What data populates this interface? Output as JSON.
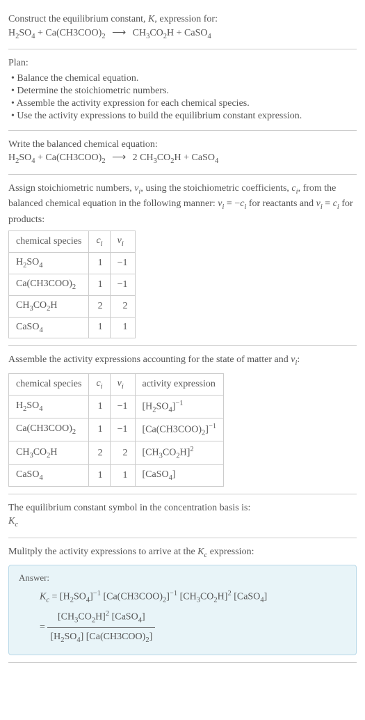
{
  "prompt": {
    "line1_a": "Construct the equilibrium constant, ",
    "line1_k": "K",
    "line1_b": ", expression for:",
    "eq_lhs1": "H",
    "eq_lhs1_sub1": "2",
    "eq_lhs1_mid": "SO",
    "eq_lhs1_sub2": "4",
    "eq_plus1": " + Ca(CH3COO)",
    "eq_plus1_sub": "2",
    "eq_arrow": "⟶",
    "eq_rhs1": "CH",
    "eq_rhs1_sub1": "3",
    "eq_rhs1_mid": "CO",
    "eq_rhs1_sub2": "2",
    "eq_rhs1_end": "H + CaSO",
    "eq_rhs1_sub3": "4"
  },
  "plan": {
    "title": "Plan:",
    "b1": "• Balance the chemical equation.",
    "b2": "• Determine the stoichiometric numbers.",
    "b3": "• Assemble the activity expression for each chemical species.",
    "b4": "• Use the activity expressions to build the equilibrium constant expression."
  },
  "balanced": {
    "title": "Write the balanced chemical equation:",
    "lhs1": "H",
    "lhs1_s1": "2",
    "lhs1_m": "SO",
    "lhs1_s2": "4",
    "plus": " + Ca(CH3COO)",
    "plus_s": "2",
    "arrow": "⟶",
    "rhs_coef": "2 CH",
    "rhs_s1": "3",
    "rhs_m": "CO",
    "rhs_s2": "2",
    "rhs_end": "H + CaSO",
    "rhs_s3": "4"
  },
  "stoich": {
    "text_a": "Assign stoichiometric numbers, ",
    "nu": "ν",
    "sub_i": "i",
    "text_b": ", using the stoichiometric coefficients, ",
    "c": "c",
    "text_c": ", from the balanced chemical equation in the following manner: ",
    "eq1": " = −",
    "text_d": " for reactants and ",
    "eq2": " = ",
    "text_e": " for products:",
    "h_species": "chemical species",
    "h_c": "c",
    "h_nu": "ν",
    "rows": [
      {
        "sp_a": "H",
        "sp_s1": "2",
        "sp_m": "SO",
        "sp_s2": "4",
        "sp_end": "",
        "c": "1",
        "nu": "−1"
      },
      {
        "sp_a": "Ca(CH3COO)",
        "sp_s1": "2",
        "sp_m": "",
        "sp_s2": "",
        "sp_end": "",
        "c": "1",
        "nu": "−1"
      },
      {
        "sp_a": "CH",
        "sp_s1": "3",
        "sp_m": "CO",
        "sp_s2": "2",
        "sp_end": "H",
        "c": "2",
        "nu": "2"
      },
      {
        "sp_a": "CaSO",
        "sp_s1": "4",
        "sp_m": "",
        "sp_s2": "",
        "sp_end": "",
        "c": "1",
        "nu": "1"
      }
    ]
  },
  "activity": {
    "text_a": "Assemble the activity expressions accounting for the state of matter and ",
    "text_b": ":",
    "h_species": "chemical species",
    "h_c": "c",
    "h_nu": "ν",
    "h_act": "activity expression",
    "rows": [
      {
        "sp_a": "H",
        "sp_s1": "2",
        "sp_m": "SO",
        "sp_s2": "4",
        "sp_end": "",
        "c": "1",
        "nu": "−1",
        "act_pre": "[H",
        "act_s1": "2",
        "act_m": "SO",
        "act_s2": "4",
        "act_end": "]",
        "act_exp": "−1"
      },
      {
        "sp_a": "Ca(CH3COO)",
        "sp_s1": "2",
        "sp_m": "",
        "sp_s2": "",
        "sp_end": "",
        "c": "1",
        "nu": "−1",
        "act_pre": "[Ca(CH3COO)",
        "act_s1": "2",
        "act_m": "",
        "act_s2": "",
        "act_end": "]",
        "act_exp": "−1"
      },
      {
        "sp_a": "CH",
        "sp_s1": "3",
        "sp_m": "CO",
        "sp_s2": "2",
        "sp_end": "H",
        "c": "2",
        "nu": "2",
        "act_pre": "[CH",
        "act_s1": "3",
        "act_m": "CO",
        "act_s2": "2",
        "act_end": "H]",
        "act_exp": "2"
      },
      {
        "sp_a": "CaSO",
        "sp_s1": "4",
        "sp_m": "",
        "sp_s2": "",
        "sp_end": "",
        "c": "1",
        "nu": "1",
        "act_pre": "[CaSO",
        "act_s1": "4",
        "act_m": "",
        "act_s2": "",
        "act_end": "]",
        "act_exp": ""
      }
    ]
  },
  "symbol": {
    "text": "The equilibrium constant symbol in the concentration basis is:",
    "k": "K",
    "k_sub": "c"
  },
  "mult": {
    "text_a": "Mulitply the activity expressions to arrive at the ",
    "k": "K",
    "k_sub": "c",
    "text_b": " expression:"
  },
  "answer": {
    "label": "Answer:",
    "k": "K",
    "k_sub": "c",
    "eq": " = ",
    "t1_a": "[H",
    "t1_s1": "2",
    "t1_m": "SO",
    "t1_s2": "4",
    "t1_end": "]",
    "t1_exp": "−1",
    "t2_a": " [Ca(CH3COO)",
    "t2_s1": "2",
    "t2_end": "]",
    "t2_exp": "−1",
    "t3_a": " [CH",
    "t3_s1": "3",
    "t3_m": "CO",
    "t3_s2": "2",
    "t3_end": "H]",
    "t3_exp": "2",
    "t4_a": " [CaSO",
    "t4_s1": "4",
    "t4_end": "]",
    "eq2": " = ",
    "num_a": "[CH",
    "num_s1": "3",
    "num_m": "CO",
    "num_s2": "2",
    "num_end": "H]",
    "num_exp": "2",
    "num2_a": " [CaSO",
    "num2_s1": "4",
    "num2_end": "]",
    "den_a": "[H",
    "den_s1": "2",
    "den_m": "SO",
    "den_s2": "4",
    "den_end": "]",
    "den2_a": " [Ca(CH3COO)",
    "den2_s1": "2",
    "den2_end": "]"
  }
}
